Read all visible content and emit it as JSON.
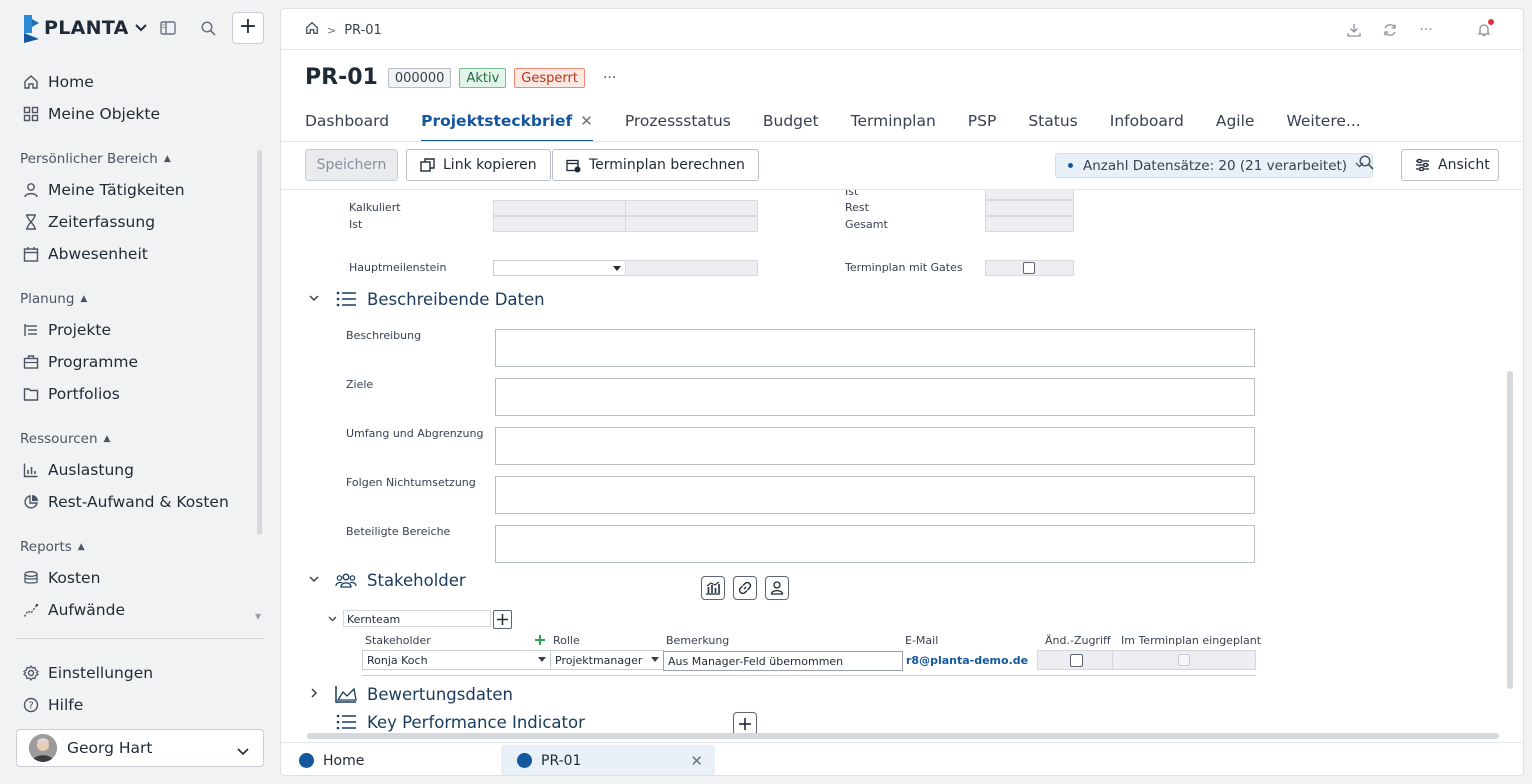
{
  "app": {
    "brand": "PLANTA",
    "accent_color": "#14579c"
  },
  "sidebar": {
    "top_items": [
      {
        "label": "Home",
        "icon": "home-icon"
      },
      {
        "label": "Meine Objekte",
        "icon": "grid-icon"
      }
    ],
    "sections": [
      {
        "title": "Persönlicher Bereich",
        "items": [
          {
            "label": "Meine Tätigkeiten",
            "icon": "person-icon"
          },
          {
            "label": "Zeiterfassung",
            "icon": "hourglass-icon"
          },
          {
            "label": "Abwesenheit",
            "icon": "calendar-icon"
          }
        ]
      },
      {
        "title": "Planung",
        "items": [
          {
            "label": "Projekte",
            "icon": "project-list-icon"
          },
          {
            "label": "Programme",
            "icon": "briefcase-icon"
          },
          {
            "label": "Portfolios",
            "icon": "folder-icon"
          }
        ]
      },
      {
        "title": "Ressourcen",
        "items": [
          {
            "label": "Auslastung",
            "icon": "bar-chart-icon"
          },
          {
            "label": "Rest-Aufwand & Kosten",
            "icon": "pie-chart-icon"
          }
        ]
      },
      {
        "title": "Reports",
        "items": [
          {
            "label": "Kosten",
            "icon": "coins-icon"
          },
          {
            "label": "Aufwände",
            "icon": "trend-icon"
          }
        ]
      }
    ],
    "bottom_items": [
      {
        "label": "Einstellungen",
        "icon": "gear-icon"
      },
      {
        "label": "Hilfe",
        "icon": "help-icon"
      }
    ],
    "user": {
      "name": "Georg Hart"
    }
  },
  "breadcrumb": {
    "current": "PR-01"
  },
  "header": {
    "title": "PR-01",
    "badges": {
      "id": "000000",
      "status": "Aktiv",
      "lock": "Gesperrt"
    },
    "more": "···"
  },
  "tabs": [
    {
      "label": "Dashboard"
    },
    {
      "label": "Projektsteckbrief",
      "active": true
    },
    {
      "label": "Prozessstatus"
    },
    {
      "label": "Budget"
    },
    {
      "label": "Terminplan"
    },
    {
      "label": "PSP"
    },
    {
      "label": "Status"
    },
    {
      "label": "Infoboard"
    },
    {
      "label": "Agile"
    },
    {
      "label": "Weitere..."
    }
  ],
  "toolbar": {
    "save": "Speichern",
    "copy_link": "Link kopieren",
    "calc_schedule": "Terminplan berechnen",
    "dataset": "Anzahl Datensätze: 20 (21 verarbeitet)",
    "view": "Ansicht"
  },
  "form": {
    "dates": {
      "left_labels": {
        "kalkuliert": "Kalkuliert",
        "ist": "Ist",
        "hauptmeilenstein": "Hauptmeilenstein"
      },
      "right_labels": {
        "ist": "Ist",
        "rest": "Rest",
        "gesamt": "Gesamt",
        "gates": "Terminplan mit Gates"
      }
    },
    "beschreibende_daten": {
      "title": "Beschreibende Daten",
      "fields": [
        {
          "label": "Beschreibung",
          "value": ""
        },
        {
          "label": "Ziele",
          "value": ""
        },
        {
          "label": "Umfang und Abgrenzung",
          "value": ""
        },
        {
          "label": "Folgen Nichtumsetzung",
          "value": ""
        },
        {
          "label": "Beteiligte Bereiche",
          "value": ""
        }
      ]
    },
    "stakeholder": {
      "title": "Stakeholder",
      "group": "Kernteam",
      "columns": {
        "stakeholder": "Stakeholder",
        "rolle": "Rolle",
        "bemerkung": "Bemerkung",
        "email": "E-Mail",
        "aend_zugriff": "Änd.-Zugriff",
        "terminplan": "Im Terminplan eingeplant"
      },
      "rows": [
        {
          "stakeholder": "Ronja Koch",
          "rolle": "Projektmanager",
          "bemerkung": "Aus Manager-Feld übernommen",
          "email": "r8@planta-demo.de"
        }
      ]
    },
    "bewertungsdaten": {
      "title": "Bewertungsdaten"
    },
    "kpi": {
      "title": "Key Performance Indicator"
    }
  },
  "bottom_tabs": [
    {
      "label": "Home"
    },
    {
      "label": "PR-01",
      "active": true
    }
  ]
}
